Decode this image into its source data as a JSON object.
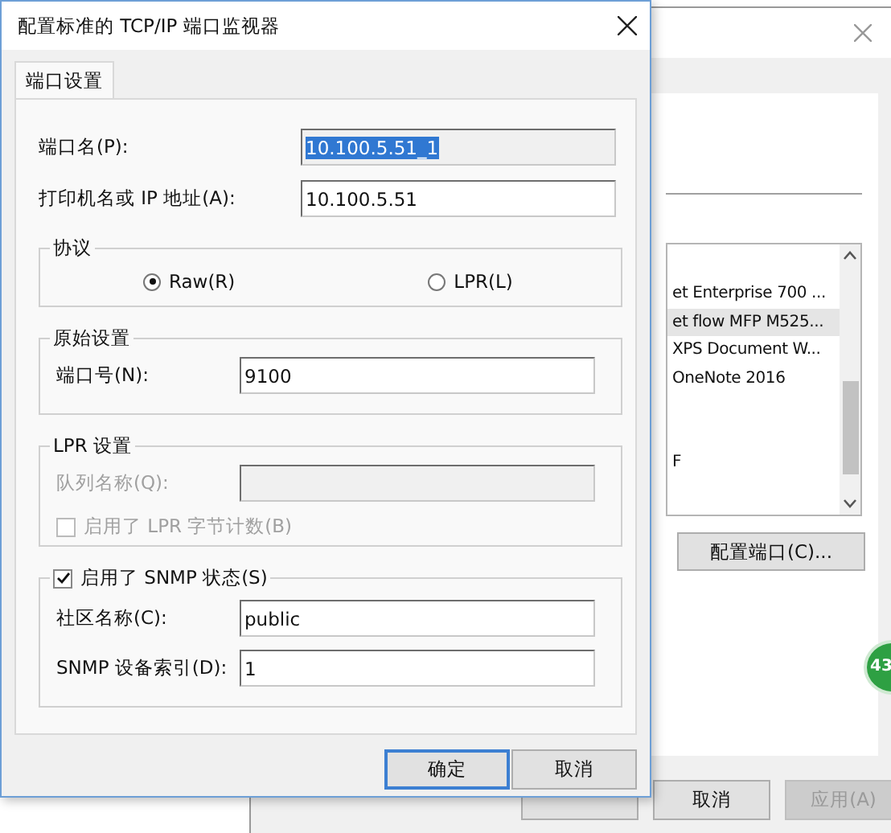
{
  "background_window": {
    "printer_list": {
      "items": [
        {
          "label": "et Enterprise 700 ...",
          "selected": false
        },
        {
          "label": "et flow MFP M525...",
          "selected": true
        },
        {
          "label": "XPS Document W...",
          "selected": false
        },
        {
          "label": "OneNote 2016",
          "selected": false
        },
        {
          "selected": false
        },
        {
          "selected": false
        },
        {
          "label": "F",
          "selected": false
        }
      ]
    },
    "configure_port_button": "配置端口(C)...",
    "buttons": [
      {
        "label": "取消",
        "disabled": false
      },
      {
        "label": "应用(A)",
        "disabled": true
      }
    ]
  },
  "badge": "43",
  "dialog": {
    "title": "配置标准的 TCP/IP 端口监视器",
    "tabs": [
      {
        "label": "端口设置",
        "selected": true
      }
    ],
    "port_name": {
      "label": "端口名(P):",
      "value": "10.100.5.51_1",
      "readonly": true,
      "selected": true
    },
    "printer_name": {
      "label": "打印机名或 IP 地址(A):",
      "value": "10.100.5.51",
      "readonly": false,
      "selected": false
    },
    "protocol": {
      "title": "协议",
      "options": [
        {
          "label": "Raw(R)",
          "selected": true
        },
        {
          "label": "LPR(L)",
          "selected": false
        }
      ]
    },
    "raw_settings": {
      "title": "原始设置",
      "port_number": {
        "label": "端口号(N):",
        "value": "9100"
      }
    },
    "lpr_settings": {
      "title": "LPR 设置",
      "disabled": true,
      "queue_name": {
        "label": "队列名称(Q):"
      },
      "byte_counting": {
        "label": "启用了 LPR 字节计数(B)",
        "checked": false
      }
    },
    "snmp": {
      "label": "启用了 SNMP 状态(S)",
      "checked": true,
      "community_name": {
        "label": "社区名称(C):",
        "value": "public"
      },
      "device_index": {
        "label": "SNMP 设备索引(D):",
        "value": "1"
      }
    },
    "buttons": [
      {
        "label": "确定",
        "default": true
      },
      {
        "label": "取消",
        "default": false
      }
    ]
  }
}
